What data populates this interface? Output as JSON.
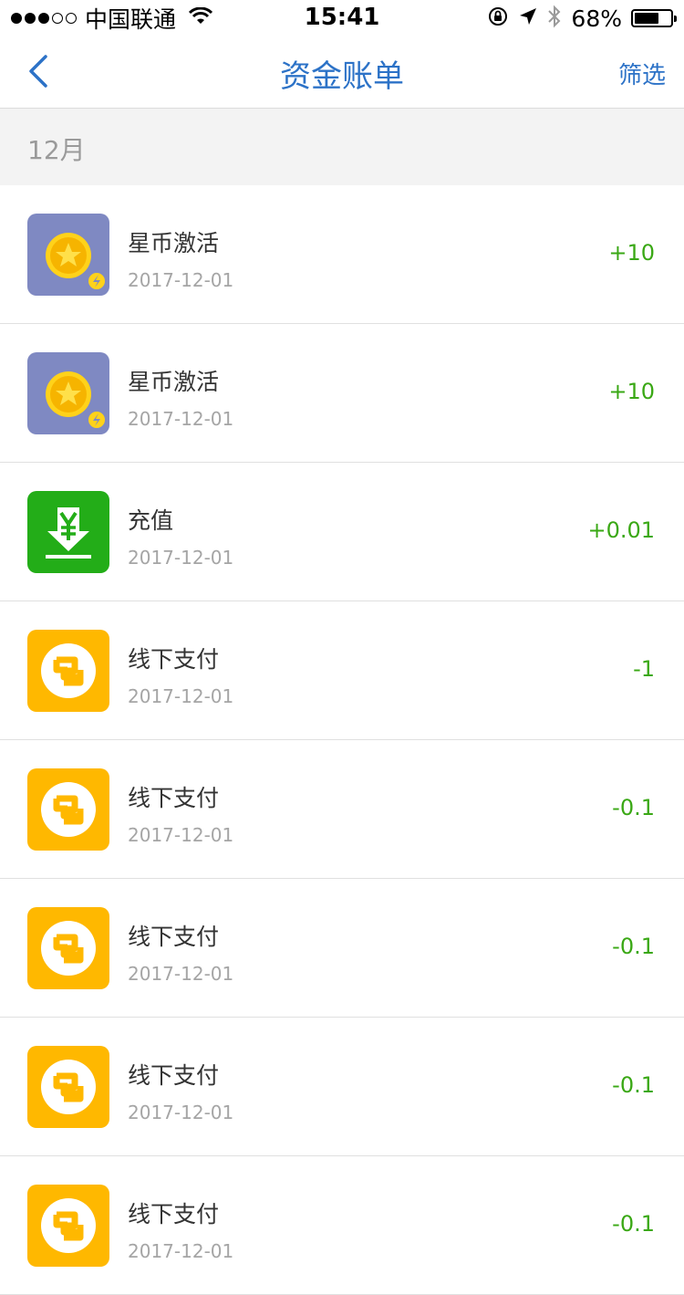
{
  "status_bar": {
    "carrier": "中国联通",
    "time": "15:41",
    "battery": "68%",
    "battery_level": 0.68,
    "signal_bars": 3,
    "signal_total": 5
  },
  "nav": {
    "title": "资金账单",
    "filter_label": "筛选"
  },
  "section": {
    "month_label": "12月"
  },
  "colors": {
    "accent": "#2c72c7",
    "amount": "#3aa815",
    "coin_bg": "#7f89c2",
    "recharge_bg": "#23ad18",
    "payment_bg": "#ffb800"
  },
  "transactions": [
    {
      "icon": "star-coin-icon",
      "title": "星币激活",
      "date": "2017-12-01",
      "amount": "+10"
    },
    {
      "icon": "star-coin-icon",
      "title": "星币激活",
      "date": "2017-12-01",
      "amount": "+10"
    },
    {
      "icon": "recharge-yen-icon",
      "title": "充值",
      "date": "2017-12-01",
      "amount": "+0.01"
    },
    {
      "icon": "offline-pay-icon",
      "title": "线下支付",
      "date": "2017-12-01",
      "amount": "-1"
    },
    {
      "icon": "offline-pay-icon",
      "title": "线下支付",
      "date": "2017-12-01",
      "amount": "-0.1"
    },
    {
      "icon": "offline-pay-icon",
      "title": "线下支付",
      "date": "2017-12-01",
      "amount": "-0.1"
    },
    {
      "icon": "offline-pay-icon",
      "title": "线下支付",
      "date": "2017-12-01",
      "amount": "-0.1"
    },
    {
      "icon": "offline-pay-icon",
      "title": "线下支付",
      "date": "2017-12-01",
      "amount": "-0.1"
    }
  ]
}
